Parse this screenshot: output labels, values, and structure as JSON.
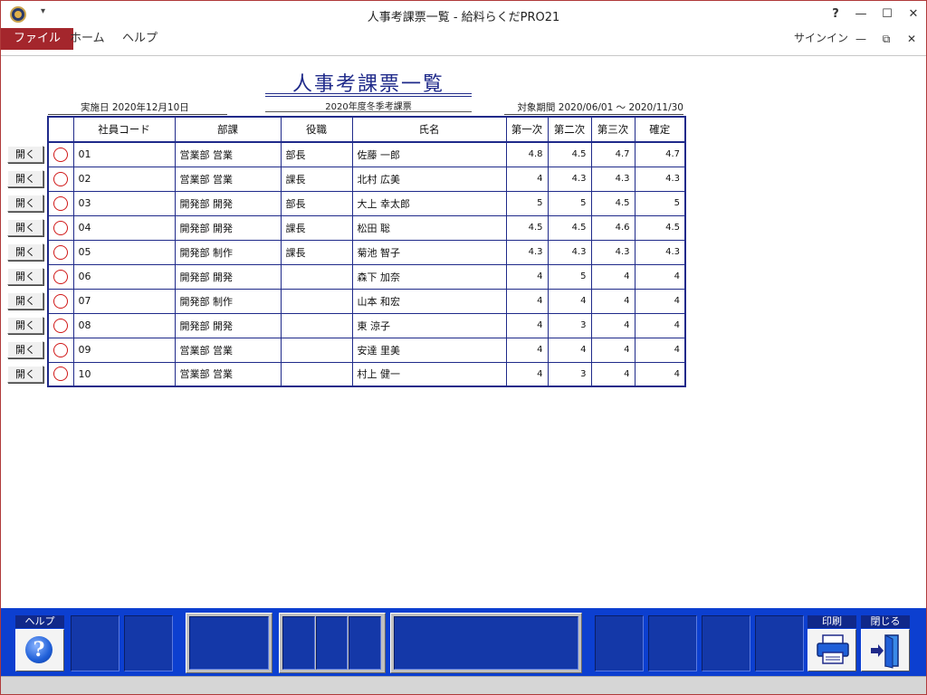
{
  "window": {
    "title": "人事考課票一覧 - 給料らくだPRO21",
    "help": "?",
    "minimize": "—",
    "maximize": "☐",
    "close": "✕",
    "qat": "▾"
  },
  "ribbon": {
    "tabs": [
      "ファイル",
      "ホーム",
      "ヘルプ"
    ],
    "signin": "サインイン",
    "sub_minimize": "—",
    "sub_restore": "⧉",
    "sub_close": "✕"
  },
  "report": {
    "title": "人事考課票一覧",
    "subtitle": "2020年度冬季考課票",
    "exec_date": "実施日 2020年12月10日",
    "period": "対象期間 2020/06/01 ～ 2020/11/30"
  },
  "table": {
    "headers": [
      "",
      "社員コード",
      "部課",
      "役職",
      "氏名",
      "第一次",
      "第二次",
      "第三次",
      "確定"
    ],
    "rows": [
      {
        "code": "01",
        "dept": "営業部 営業",
        "position": "部長",
        "name": "佐藤 一郎",
        "r1": "4.8",
        "r2": "4.5",
        "r3": "4.7",
        "final": "4.7"
      },
      {
        "code": "02",
        "dept": "営業部 営業",
        "position": "課長",
        "name": "北村 広美",
        "r1": "4",
        "r2": "4.3",
        "r3": "4.3",
        "final": "4.3"
      },
      {
        "code": "03",
        "dept": "開発部 開発",
        "position": "部長",
        "name": "大上 幸太郎",
        "r1": "5",
        "r2": "5",
        "r3": "4.5",
        "final": "5"
      },
      {
        "code": "04",
        "dept": "開発部 開発",
        "position": "課長",
        "name": "松田 聡",
        "r1": "4.5",
        "r2": "4.5",
        "r3": "4.6",
        "final": "4.5"
      },
      {
        "code": "05",
        "dept": "開発部 制作",
        "position": "課長",
        "name": "菊池 智子",
        "r1": "4.3",
        "r2": "4.3",
        "r3": "4.3",
        "final": "4.3"
      },
      {
        "code": "06",
        "dept": "開発部 開発",
        "position": "",
        "name": "森下 加奈",
        "r1": "4",
        "r2": "5",
        "r3": "4",
        "final": "4"
      },
      {
        "code": "07",
        "dept": "開発部 制作",
        "position": "",
        "name": "山本 和宏",
        "r1": "4",
        "r2": "4",
        "r3": "4",
        "final": "4"
      },
      {
        "code": "08",
        "dept": "開発部 開発",
        "position": "",
        "name": "東 涼子",
        "r1": "4",
        "r2": "3",
        "r3": "4",
        "final": "4"
      },
      {
        "code": "09",
        "dept": "営業部 営業",
        "position": "",
        "name": "安達 里美",
        "r1": "4",
        "r2": "4",
        "r3": "4",
        "final": "4"
      },
      {
        "code": "10",
        "dept": "営業部 営業",
        "position": "",
        "name": "村上 健一",
        "r1": "4",
        "r2": "3",
        "r3": "4",
        "final": "4"
      }
    ],
    "open_label": "開く"
  },
  "toolbar": {
    "help_label": "ヘルプ",
    "help_glyph": "?",
    "print_label": "印刷",
    "close_label": "閉じる"
  },
  "colors": {
    "accent": "#a4262c",
    "table_border": "#1f2a8a",
    "toolbar_bg": "#0c3fd0",
    "circle": "#d01818"
  }
}
